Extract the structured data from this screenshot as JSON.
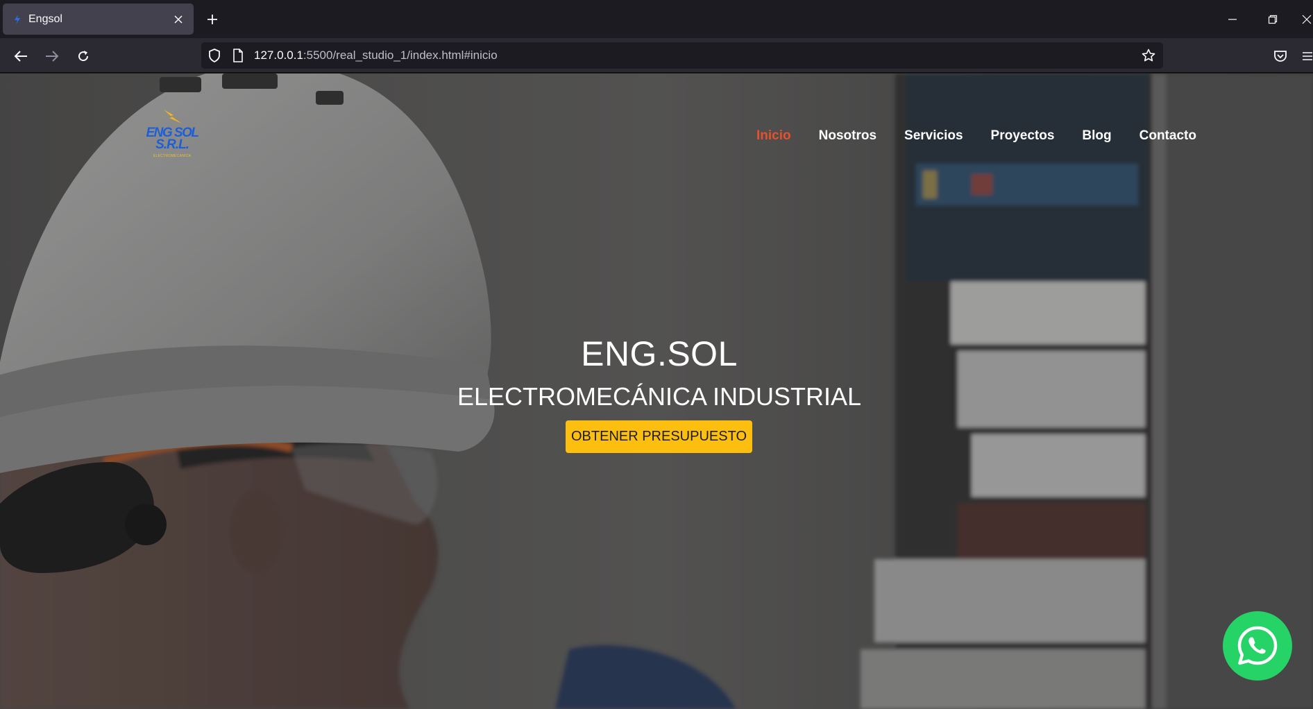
{
  "browser": {
    "tab_title": "Engsol",
    "url_host": "127.0.0.1",
    "url_rest": ":5500/real_studio_1/index.html#inicio"
  },
  "site": {
    "logo": {
      "line1": "ENG SOL",
      "line2": "S.R.L.",
      "tagline": "ELECTROMECANICA"
    },
    "nav": [
      {
        "label": "Inicio",
        "active": true
      },
      {
        "label": "Nosotros",
        "active": false
      },
      {
        "label": "Servicios",
        "active": false
      },
      {
        "label": "Proyectos",
        "active": false
      },
      {
        "label": "Blog",
        "active": false
      },
      {
        "label": "Contacto",
        "active": false
      }
    ],
    "hero": {
      "title": "ENG.SOL",
      "subtitle": "ELECTROMECÁNICA INDUSTRIAL",
      "cta_label": "OBTENER PRESUPUESTO"
    }
  },
  "colors": {
    "nav_active": "#e8502e",
    "cta_bg": "#fdbf0f",
    "whatsapp": "#25d366",
    "logo_blue": "#1d5fd6"
  },
  "icons": {
    "whatsapp": "whatsapp-icon"
  }
}
